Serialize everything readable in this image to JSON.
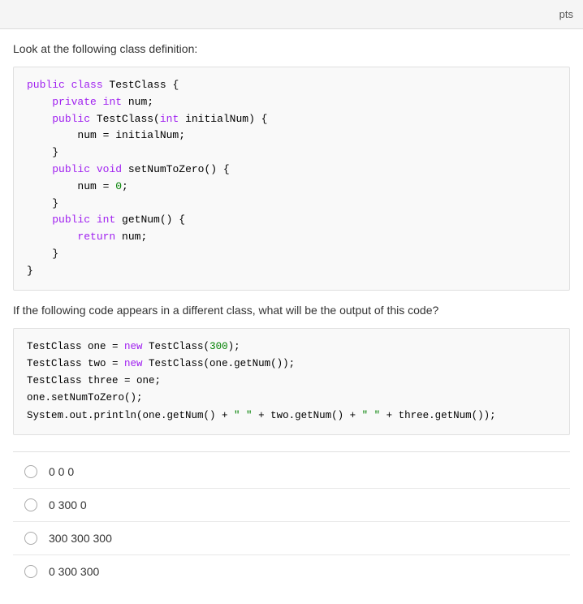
{
  "header": {
    "pts_label": "pts"
  },
  "instruction": "Look at the following class definition:",
  "class_code": {
    "lines": [
      {
        "parts": [
          {
            "text": "public ",
            "style": "kw-purple"
          },
          {
            "text": "class",
            "style": "kw-purple"
          },
          {
            "text": " TestClass {",
            "style": "kw-black"
          }
        ]
      },
      {
        "parts": [
          {
            "text": "    ",
            "style": ""
          },
          {
            "text": "private",
            "style": "kw-purple"
          },
          {
            "text": " ",
            "style": ""
          },
          {
            "text": "int",
            "style": "kw-purple"
          },
          {
            "text": " num;",
            "style": "kw-black"
          }
        ]
      },
      {
        "parts": [
          {
            "text": "    ",
            "style": ""
          },
          {
            "text": "public",
            "style": "kw-purple"
          },
          {
            "text": " TestClass(",
            "style": "kw-black"
          },
          {
            "text": "int",
            "style": "kw-purple"
          },
          {
            "text": " initialNum) {",
            "style": "kw-black"
          }
        ]
      },
      {
        "parts": [
          {
            "text": "        num = initialNum;",
            "style": "kw-black"
          }
        ]
      },
      {
        "parts": [
          {
            "text": "    }",
            "style": "kw-black"
          }
        ]
      },
      {
        "parts": [
          {
            "text": "    ",
            "style": ""
          },
          {
            "text": "public",
            "style": "kw-purple"
          },
          {
            "text": " ",
            "style": ""
          },
          {
            "text": "void",
            "style": "kw-purple"
          },
          {
            "text": " setNumToZero() {",
            "style": "kw-black"
          }
        ]
      },
      {
        "parts": [
          {
            "text": "        num = ",
            "style": "kw-black"
          },
          {
            "text": "0",
            "style": "kw-green"
          },
          {
            "text": ";",
            "style": "kw-black"
          }
        ]
      },
      {
        "parts": [
          {
            "text": "    }",
            "style": "kw-black"
          }
        ]
      },
      {
        "parts": [
          {
            "text": "    ",
            "style": ""
          },
          {
            "text": "public",
            "style": "kw-purple"
          },
          {
            "text": " ",
            "style": ""
          },
          {
            "text": "int",
            "style": "kw-purple"
          },
          {
            "text": " getNum() {",
            "style": "kw-black"
          }
        ]
      },
      {
        "parts": [
          {
            "text": "        ",
            "style": ""
          },
          {
            "text": "return",
            "style": "kw-purple"
          },
          {
            "text": " num;",
            "style": "kw-black"
          }
        ]
      },
      {
        "parts": [
          {
            "text": "    }",
            "style": "kw-black"
          }
        ]
      },
      {
        "parts": [
          {
            "text": "}",
            "style": "kw-black"
          }
        ]
      }
    ]
  },
  "question_text": "If the following code appears in a different class, what will be the output of this code?",
  "run_code": {
    "lines": [
      {
        "parts": [
          {
            "text": "TestClass one = ",
            "style": "kw-black"
          },
          {
            "text": "new",
            "style": "kw-purple"
          },
          {
            "text": " TestClass(",
            "style": "kw-black"
          },
          {
            "text": "300",
            "style": "kw-green"
          },
          {
            "text": ");",
            "style": "kw-black"
          }
        ]
      },
      {
        "parts": [
          {
            "text": "TestClass two = ",
            "style": "kw-black"
          },
          {
            "text": "new",
            "style": "kw-purple"
          },
          {
            "text": " TestClass(one.getNum());",
            "style": "kw-black"
          }
        ]
      },
      {
        "parts": [
          {
            "text": "TestClass three = one;",
            "style": "kw-black"
          }
        ]
      },
      {
        "parts": [
          {
            "text": "one.setNumToZero();",
            "style": "kw-black"
          }
        ]
      },
      {
        "parts": [
          {
            "text": "System.out.println(one.getNum() + ",
            "style": "kw-black"
          },
          {
            "text": "\" \"",
            "style": "kw-green"
          },
          {
            "text": " + two.getNum() + ",
            "style": "kw-black"
          },
          {
            "text": "\" \"",
            "style": "kw-green"
          },
          {
            "text": " + three.getNum());",
            "style": "kw-black"
          }
        ]
      }
    ]
  },
  "options": [
    {
      "id": "opt1",
      "label": "0 0 0"
    },
    {
      "id": "opt2",
      "label": "0 300 0"
    },
    {
      "id": "opt3",
      "label": "300 300 300"
    },
    {
      "id": "opt4",
      "label": "0 300 300"
    }
  ]
}
